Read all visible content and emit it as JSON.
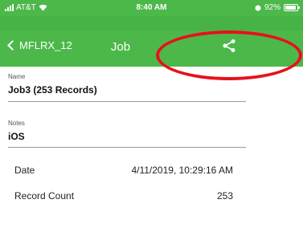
{
  "status_bar": {
    "carrier": "AT&T",
    "time": "8:40 AM",
    "battery": "92%",
    "battery_level": 0.92
  },
  "nav": {
    "back_label": "MFLRX_12",
    "title": "Job",
    "share_icon": "share-icon"
  },
  "form": {
    "name_label": "Name",
    "name_value": "Job3 (253 Records)",
    "notes_label": "Notes",
    "notes_value": "iOS"
  },
  "details": {
    "date_label": "Date",
    "date_value": "4/11/2019, 10:29:16 AM",
    "record_count_label": "Record Count",
    "record_count_value": "253"
  },
  "colors": {
    "nav_green": "#4cb84a",
    "annotation_red": "#e8101c"
  }
}
